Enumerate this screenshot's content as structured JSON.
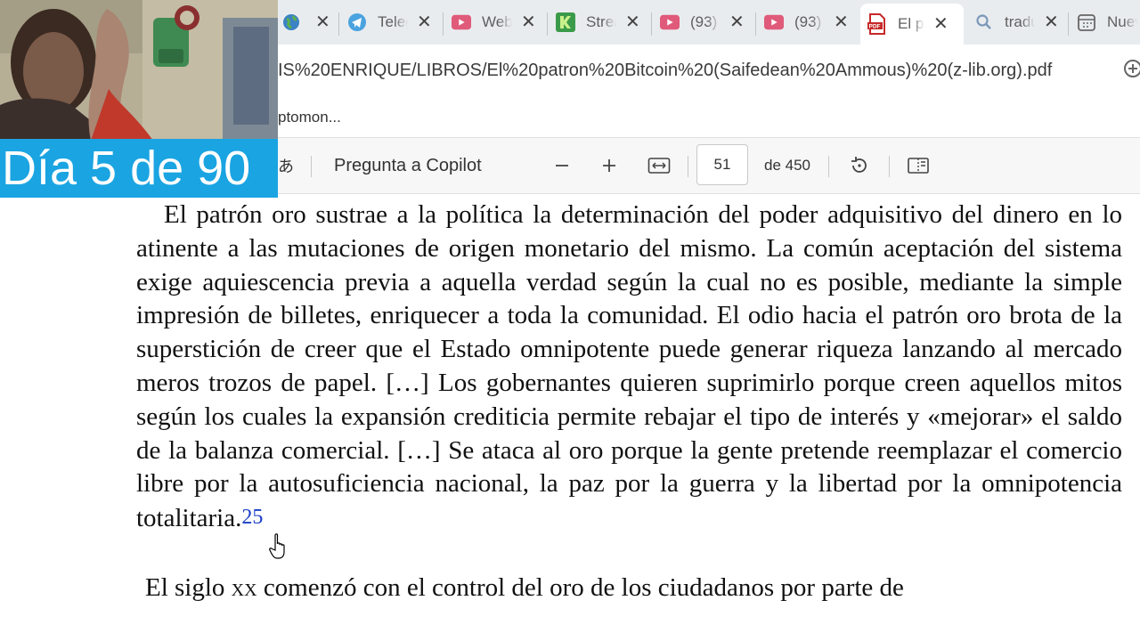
{
  "tabs": [
    {
      "title": "",
      "icon": "globe-icon",
      "active": false
    },
    {
      "title": "Telegram",
      "icon": "telegram-icon",
      "active": false
    },
    {
      "title": "WebTV",
      "icon": "youtube-icon",
      "active": false
    },
    {
      "title": "Stream",
      "icon": "kick-icon",
      "active": false
    },
    {
      "title": "(93)",
      "icon": "youtube-icon",
      "active": false
    },
    {
      "title": "(93)",
      "icon": "youtube-icon",
      "active": false
    },
    {
      "title": "El patron",
      "icon": "pdf-icon",
      "active": true
    },
    {
      "title": "traductor",
      "icon": "search-icon",
      "active": false
    },
    {
      "title": "Nueva",
      "icon": "calendar-icon",
      "active": false
    }
  ],
  "address": {
    "url": "IS%20ENRIQUE/LIBROS/El%20patron%20Bitcoin%20(Saifedean%20Ammous)%20(z-lib.org).pdf"
  },
  "favorites": {
    "item": "ptomon..."
  },
  "pdf_toolbar": {
    "read_aloud_glyph": "あ",
    "copilot_label": "Pregunta a Copilot",
    "page_current": "51",
    "page_total": "de 450"
  },
  "document": {
    "paragraph1": "El patrón oro sustrae a la política la determinación del poder adquisitivo del dinero en lo atinente a las mutaciones de origen monetario del mismo. La común aceptación del sistema exige aquiescencia previa a aquella verdad según la cual no es posible, mediante la simple impresión de billetes, enriquecer a toda la comunidad. El odio hacia el patrón oro brota de la superstición de creer que el Estado omnipotente puede generar riqueza lanzando al mercado meros trozos de papel. […] Los gobernantes quieren suprimirlo porque creen aquellos mitos según los cuales la expansión crediticia permite rebajar el tipo de interés y «mejorar» el saldo de la balanza comercial. […] Se ataca al oro porque la gente pretende reemplazar el comercio libre por la autosuficiencia nacional, la paz por la guerra y la libertad por la omnipotencia totalitaria.",
    "footnote_ref": "25",
    "paragraph2_pre": "El siglo ",
    "paragraph2_century": "xx",
    "paragraph2_post": " comenzó con el control del oro de los ciudadanos por parte de"
  },
  "overlay": {
    "banner_text": "Día 5 de 90",
    "banner_color": "#1aa4e2"
  }
}
